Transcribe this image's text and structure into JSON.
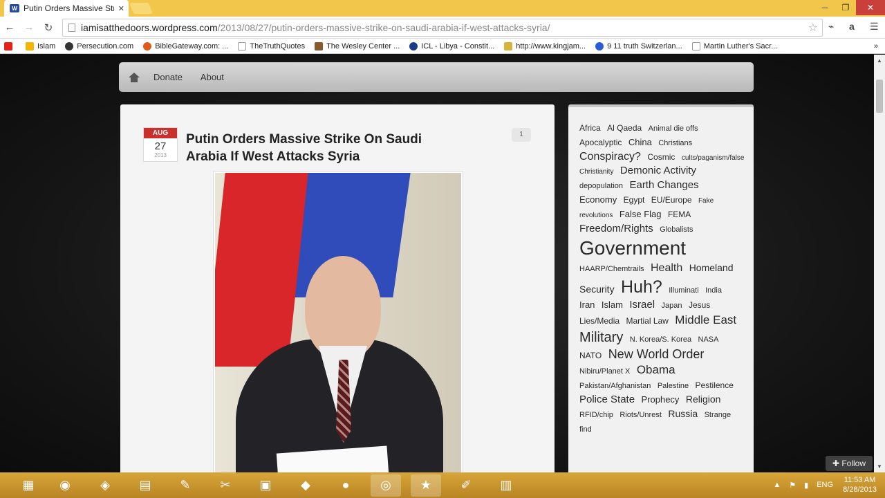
{
  "browser": {
    "tab_title": "Putin Orders Massive Stri",
    "url_host": "iamisatthedoors.wordpress.com",
    "url_path": "/2013/08/27/putin-orders-massive-strike-on-saudi-arabia-if-west-attacks-syria/",
    "bookmarks": [
      {
        "label": "Islam",
        "color": "#f4b400"
      },
      {
        "label": "Persecution.com",
        "color": "#333333"
      },
      {
        "label": "BibleGateway.com: ...",
        "color": "#e05a1a"
      },
      {
        "label": "TheTruthQuotes",
        "color": "#cccccc"
      },
      {
        "label": "The Wesley Center ...",
        "color": "#8a5a2b"
      },
      {
        "label": "ICL - Libya - Constit...",
        "color": "#1a3b8a"
      },
      {
        "label": "http://www.kingjam...",
        "color": "#d8b43a"
      },
      {
        "label": "9 11 truth Switzerlan...",
        "color": "#2a5bd8"
      },
      {
        "label": "Martin Luther's Sacr...",
        "color": "#cccccc"
      }
    ]
  },
  "site": {
    "menu": [
      "Donate",
      "About"
    ]
  },
  "post": {
    "month": "AUG",
    "day": "27",
    "year": "2013",
    "title": "Putin Orders Massive Strike On Saudi Arabia If West Attacks Syria",
    "comment_count": "1"
  },
  "tags": [
    {
      "t": "Africa",
      "s": 12
    },
    {
      "t": "Al Qaeda",
      "s": 12
    },
    {
      "t": "Animal die offs",
      "s": 11
    },
    {
      "t": "Apocalyptic",
      "s": 12
    },
    {
      "t": "China",
      "s": 13
    },
    {
      "t": "Christians",
      "s": 11
    },
    {
      "t": "Conspiracy?",
      "s": 16
    },
    {
      "t": "Cosmic",
      "s": 12
    },
    {
      "t": "cults/paganism/false Christianity",
      "s": 10
    },
    {
      "t": "Demonic Activity",
      "s": 15
    },
    {
      "t": "depopulation",
      "s": 11
    },
    {
      "t": "Earth Changes",
      "s": 15
    },
    {
      "t": "Economy",
      "s": 13
    },
    {
      "t": "Egypt",
      "s": 12
    },
    {
      "t": "EU/Europe",
      "s": 12
    },
    {
      "t": "Fake revolutions",
      "s": 10
    },
    {
      "t": "False Flag",
      "s": 13
    },
    {
      "t": "FEMA",
      "s": 12
    },
    {
      "t": "Freedom/Rights",
      "s": 15
    },
    {
      "t": "Globalists",
      "s": 11
    },
    {
      "t": "Government",
      "s": 28
    },
    {
      "t": "HAARP/Chemtrails",
      "s": 11
    },
    {
      "t": "Health",
      "s": 16
    },
    {
      "t": "Homeland Security",
      "s": 14
    },
    {
      "t": "Huh?",
      "s": 25
    },
    {
      "t": "Illuminati",
      "s": 11
    },
    {
      "t": "India",
      "s": 11
    },
    {
      "t": "Iran",
      "s": 13
    },
    {
      "t": "Islam",
      "s": 13
    },
    {
      "t": "Israel",
      "s": 15
    },
    {
      "t": "Japan",
      "s": 11
    },
    {
      "t": "Jesus",
      "s": 12
    },
    {
      "t": "Lies/Media",
      "s": 12
    },
    {
      "t": "Martial Law",
      "s": 12
    },
    {
      "t": "Middle East",
      "s": 17
    },
    {
      "t": "Military",
      "s": 20
    },
    {
      "t": "N. Korea/S. Korea",
      "s": 11
    },
    {
      "t": "NASA",
      "s": 11
    },
    {
      "t": "NATO",
      "s": 12
    },
    {
      "t": "New World Order",
      "s": 18
    },
    {
      "t": "Nibiru/Planet X",
      "s": 11
    },
    {
      "t": "Obama",
      "s": 17
    },
    {
      "t": "Pakistan/Afghanistan",
      "s": 11
    },
    {
      "t": "Palestine",
      "s": 11
    },
    {
      "t": "Pestilence",
      "s": 12
    },
    {
      "t": "Police State",
      "s": 15
    },
    {
      "t": "Prophecy",
      "s": 13
    },
    {
      "t": "Religion",
      "s": 14
    },
    {
      "t": "RFID/chip",
      "s": 11
    },
    {
      "t": "Riots/Unrest",
      "s": 11
    },
    {
      "t": "Russia",
      "s": 14
    },
    {
      "t": "Strange find",
      "s": 11
    }
  ],
  "follow_label": "Follow",
  "tray": {
    "lang": "ENG",
    "time": "11:53 AM",
    "date": "8/28/2013"
  }
}
